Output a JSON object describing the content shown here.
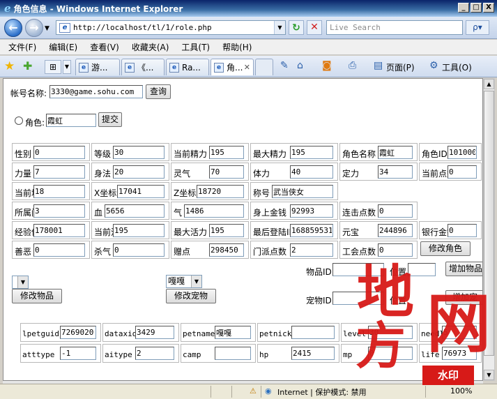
{
  "window": {
    "title": "角色信息 - Windows Internet Explorer",
    "min_label": "_",
    "max_label": "□",
    "close_label": "X"
  },
  "address_bar": {
    "url": "http://localhost/tl/1/role.php",
    "search_placeholder": "Live Search",
    "search_label": "ρ▾"
  },
  "menu": [
    "文件(F)",
    "编辑(E)",
    "查看(V)",
    "收藏夹(A)",
    "工具(T)",
    "帮助(H)"
  ],
  "tabs": [
    {
      "label": "游..."
    },
    {
      "label": "《..."
    },
    {
      "label": "Ra..."
    },
    {
      "label": "角..."
    }
  ],
  "toolbar": {
    "page_label": "页面(P)",
    "tools_label": "工具(O)"
  },
  "account_search": {
    "label": "帐号名称:",
    "value": "3330@game.sohu.com",
    "button": "查询"
  },
  "role_pick": {
    "label": "角色:",
    "value": "霞虹",
    "button": "提交"
  },
  "role_fields": [
    [
      {
        "label": "性别",
        "value": "0"
      },
      {
        "label": "等级",
        "value": "30"
      },
      {
        "label": "当前精力",
        "value": "195"
      },
      {
        "label": "最大精力",
        "value": "195"
      },
      {
        "label": "角色名称",
        "value": "霞虹"
      },
      {
        "label": "角色ID",
        "value": "10100000"
      }
    ],
    [
      {
        "label": "力量",
        "value": "7"
      },
      {
        "label": "身法",
        "value": "20"
      },
      {
        "label": "灵气",
        "value": "70"
      },
      {
        "label": "体力",
        "value": "40"
      },
      {
        "label": "定力",
        "value": "34"
      },
      {
        "label": "当前点数",
        "value": "0"
      }
    ],
    [
      {
        "label": "当前场景",
        "value": "18"
      },
      {
        "label": "X坐标",
        "value": "17041"
      },
      {
        "label": "Z坐标",
        "value": "18720"
      },
      {
        "label": "称号",
        "value": "武当侠女"
      }
    ],
    [
      {
        "label": "所属门派",
        "value": "3"
      },
      {
        "label": "血",
        "value": "5656"
      },
      {
        "label": "气",
        "value": "1486"
      },
      {
        "label": "身上金钱",
        "value": "92993"
      },
      {
        "label": "连击点数",
        "value": "0"
      }
    ],
    [
      {
        "label": "经验值",
        "value": "178001"
      },
      {
        "label": "当前活力",
        "value": "195"
      },
      {
        "label": "最大活力",
        "value": "195"
      },
      {
        "label": "最后登陆IP",
        "value": "1688595318"
      },
      {
        "label": "元宝",
        "value": "244896"
      },
      {
        "label": "银行金钱",
        "value": "0"
      }
    ],
    [
      {
        "label": "善恶",
        "value": "0"
      },
      {
        "label": "杀气",
        "value": "0"
      },
      {
        "label": "赠点",
        "value": "298450"
      },
      {
        "label": "门派点数",
        "value": "2"
      },
      {
        "label": "工会点数",
        "value": "0"
      }
    ]
  ],
  "modify_role_button": "修改角色",
  "item_form": {
    "item_id_label": "物品ID",
    "item_id_value": "",
    "position_label": "位置",
    "position_value": "",
    "add_item_button": "增加物品",
    "modify_item_button": "修改物品",
    "pet_select_value": "嘎嘎",
    "modify_pet_button": "修改宠物",
    "pet_id_label": "宠物ID",
    "pet_id_value": "",
    "pet_position_label": "位置",
    "pet_add_button": "增加宠"
  },
  "pet_fields": [
    [
      {
        "label": "lpetguid",
        "value": "7269020"
      },
      {
        "label": "dataxid",
        "value": "3429"
      },
      {
        "label": "petname",
        "value": "嘎嘎"
      },
      {
        "label": "petnick",
        "value": ""
      },
      {
        "label": "level",
        "value": "30"
      },
      {
        "label": "needlevel",
        "value": "5"
      }
    ],
    [
      {
        "label": "atttype",
        "value": "-1"
      },
      {
        "label": "aitype",
        "value": "2"
      },
      {
        "label": "camp",
        "value": ""
      },
      {
        "label": "hp",
        "value": "2415"
      },
      {
        "label": "mp",
        "value": "0"
      },
      {
        "label": "life",
        "value": "76973"
      }
    ]
  ],
  "status": {
    "zone": "Internet | 保护模式: 禁用",
    "zoom": "100%"
  },
  "watermark": {
    "text": "地方网",
    "stamp": "水印"
  }
}
